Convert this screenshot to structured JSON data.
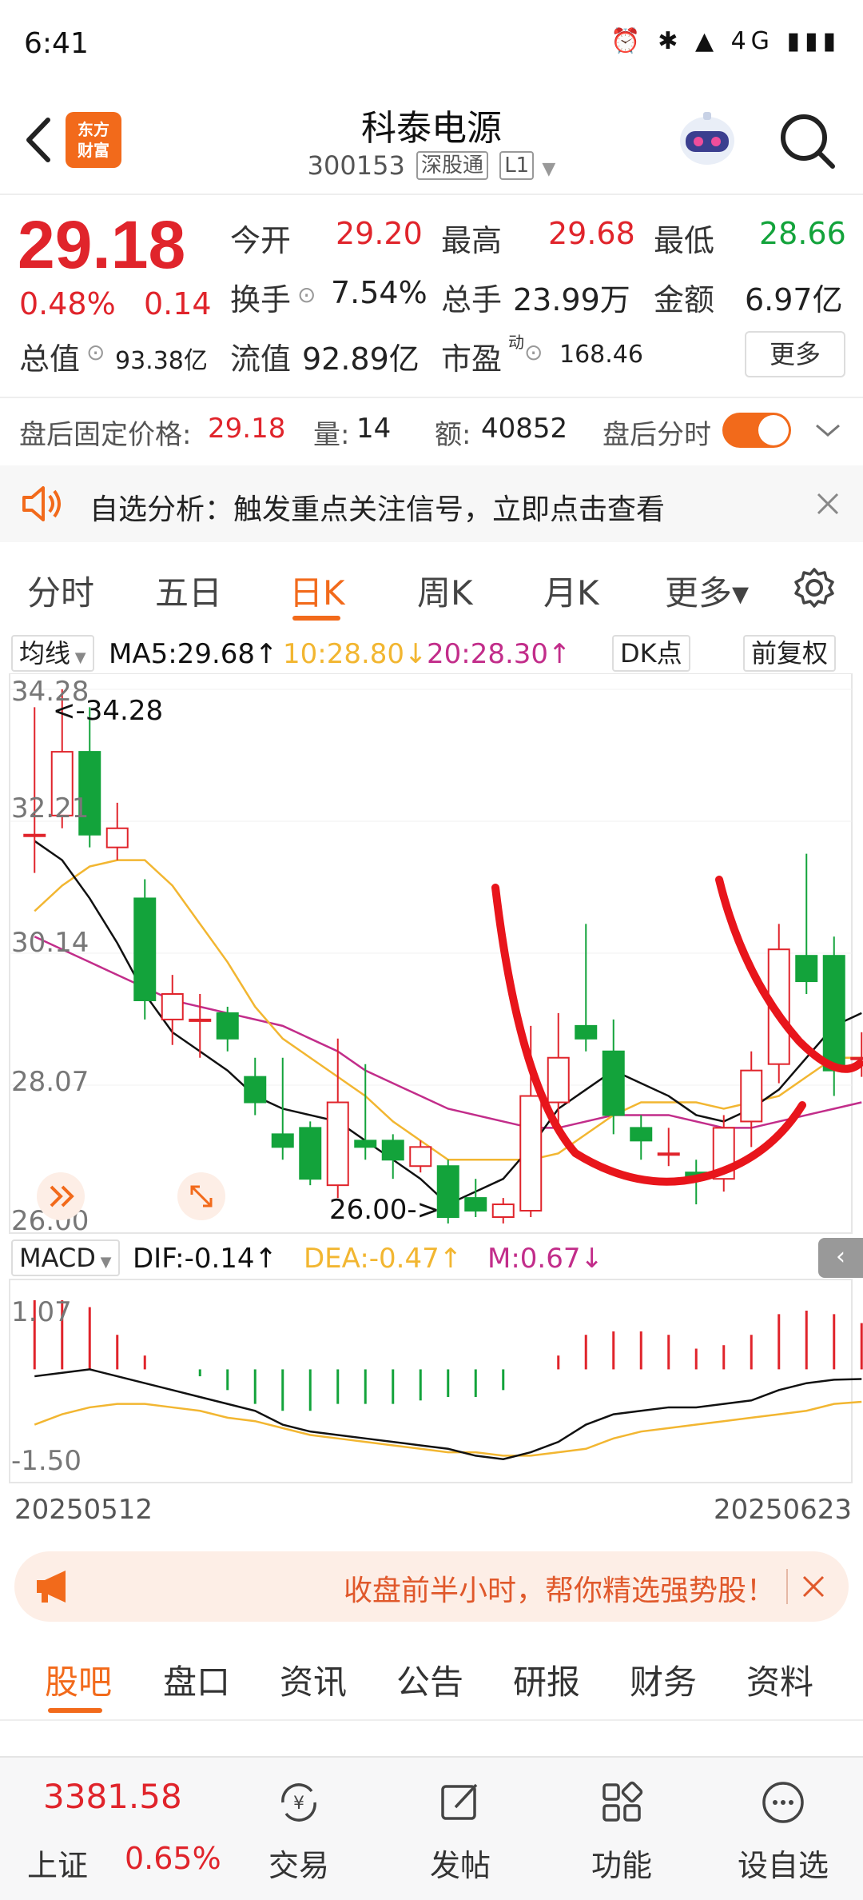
{
  "status_bar": {
    "time": "6:41",
    "icons": "⏰ ✱ ▲ 4G ▮▮▮"
  },
  "header": {
    "app_logo": "东方\n财富",
    "stock_name": "科泰电源",
    "stock_code": "300153",
    "tag_connect": "深股通",
    "tag_level": "L1"
  },
  "quote": {
    "price": "29.18",
    "pct_change": "0.48%",
    "abs_change": "0.14",
    "open_label": "今开",
    "open_value": "29.20",
    "high_label": "最高",
    "high_value": "29.68",
    "low_label": "最低",
    "low_value": "28.66",
    "turnover_label": "换手",
    "turnover_value": "7.54%",
    "volume_label": "总手",
    "volume_value": "23.99万",
    "amount_label": "金额",
    "amount_value": "6.97亿",
    "mktcap_label": "总值",
    "mktcap_value": "93.38亿",
    "float_label": "流值",
    "float_value": "92.89亿",
    "pe_label": "市盈",
    "pe_sup": "动",
    "pe_value": "168.46",
    "more_label": "更多"
  },
  "after_hours": {
    "price_label": "盘后固定价格:",
    "price_value": "29.18",
    "qty_label": "量:",
    "qty_value": "14",
    "amt_label": "额:",
    "amt_value": "40852",
    "toggle_label": "盘后分时"
  },
  "notice": {
    "text": "自选分析：触发重点关注信号，立即点击查看"
  },
  "chart_tabs": [
    "分时",
    "五日",
    "日K",
    "周K",
    "月K",
    "更多▾"
  ],
  "ma_row": {
    "selector": "均线",
    "ma5": "MA5:29.68↑",
    "ma10": "10:28.80↓",
    "ma20": "20:28.30↑",
    "dk_button": "DK点",
    "adjust_button": "前复权"
  },
  "colors": {
    "up": "#e0242b",
    "down": "#13a33b",
    "ma5": "#111111",
    "ma10": "#f2b631",
    "ma20": "#c22d8a",
    "accent": "#f26a1b"
  },
  "chart_data": {
    "type": "candlestick",
    "y_ticks": [
      "34.28",
      "32.21",
      "30.14",
      "28.07",
      "26.00"
    ],
    "ylim": [
      26.0,
      34.28
    ],
    "max_marker": "<-34.28",
    "min_marker": "26.00->",
    "candles": [
      {
        "o": 32.0,
        "c": 32.0,
        "h": 34.0,
        "l": 31.4
      },
      {
        "o": 32.3,
        "c": 33.3,
        "h": 34.28,
        "l": 32.1
      },
      {
        "o": 33.3,
        "c": 32.0,
        "h": 34.0,
        "l": 31.8
      },
      {
        "o": 31.8,
        "c": 32.1,
        "h": 32.5,
        "l": 31.6
      },
      {
        "o": 31.0,
        "c": 29.4,
        "h": 31.3,
        "l": 29.1
      },
      {
        "o": 29.1,
        "c": 29.5,
        "h": 29.8,
        "l": 28.7
      },
      {
        "o": 29.1,
        "c": 29.1,
        "h": 29.5,
        "l": 28.5
      },
      {
        "o": 29.2,
        "c": 28.8,
        "h": 29.3,
        "l": 28.6
      },
      {
        "o": 28.2,
        "c": 27.8,
        "h": 28.5,
        "l": 27.6
      },
      {
        "o": 27.3,
        "c": 27.1,
        "h": 28.5,
        "l": 26.9
      },
      {
        "o": 27.4,
        "c": 26.6,
        "h": 27.5,
        "l": 26.5
      },
      {
        "o": 26.5,
        "c": 27.8,
        "h": 28.8,
        "l": 26.3
      },
      {
        "o": 27.2,
        "c": 27.1,
        "h": 28.4,
        "l": 26.9
      },
      {
        "o": 27.2,
        "c": 26.9,
        "h": 27.3,
        "l": 26.6
      },
      {
        "o": 26.8,
        "c": 27.1,
        "h": 27.2,
        "l": 26.7
      },
      {
        "o": 26.8,
        "c": 26.0,
        "h": 26.9,
        "l": 25.9
      },
      {
        "o": 26.3,
        "c": 26.1,
        "h": 26.6,
        "l": 26.0
      },
      {
        "o": 26.0,
        "c": 26.2,
        "h": 26.3,
        "l": 25.9
      },
      {
        "o": 26.1,
        "c": 27.9,
        "h": 29.0,
        "l": 26.0
      },
      {
        "o": 27.8,
        "c": 28.5,
        "h": 29.2,
        "l": 27.4
      },
      {
        "o": 29.0,
        "c": 28.8,
        "h": 30.6,
        "l": 28.6
      },
      {
        "o": 28.6,
        "c": 27.6,
        "h": 29.1,
        "l": 27.3
      },
      {
        "o": 27.4,
        "c": 27.2,
        "h": 27.6,
        "l": 26.9
      },
      {
        "o": 27.0,
        "c": 27.0,
        "h": 27.4,
        "l": 26.8
      },
      {
        "o": 26.7,
        "c": 26.6,
        "h": 26.9,
        "l": 26.2
      },
      {
        "o": 26.6,
        "c": 27.4,
        "h": 27.6,
        "l": 26.4
      },
      {
        "o": 27.5,
        "c": 28.3,
        "h": 28.6,
        "l": 27.1
      },
      {
        "o": 28.4,
        "c": 30.2,
        "h": 30.6,
        "l": 28.1
      },
      {
        "o": 30.1,
        "c": 29.7,
        "h": 31.7,
        "l": 29.5
      },
      {
        "o": 30.1,
        "c": 28.3,
        "h": 30.4,
        "l": 27.9
      },
      {
        "o": 28.5,
        "c": 28.5,
        "h": 28.9,
        "l": 28.2
      }
    ],
    "ma5": [
      31.9,
      31.6,
      31.0,
      30.3,
      29.5,
      28.9,
      28.6,
      28.3,
      27.9,
      27.7,
      27.6,
      27.5,
      27.2,
      26.9,
      26.6,
      26.2,
      26.4,
      26.6,
      27.1,
      27.7,
      28.0,
      28.3,
      28.1,
      27.9,
      27.6,
      27.5,
      27.7,
      28.0,
      28.5,
      29.0,
      29.2
    ],
    "ma10": [
      30.8,
      31.2,
      31.5,
      31.6,
      31.6,
      31.2,
      30.6,
      30.0,
      29.3,
      28.8,
      28.5,
      28.2,
      27.9,
      27.5,
      27.2,
      26.9,
      26.9,
      26.9,
      26.9,
      27.0,
      27.3,
      27.6,
      27.8,
      27.8,
      27.8,
      27.7,
      27.8,
      27.9,
      28.2,
      28.5,
      28.5
    ],
    "ma20": [
      30.4,
      30.2,
      30.0,
      29.8,
      29.6,
      29.4,
      29.3,
      29.2,
      29.1,
      29.0,
      28.8,
      28.6,
      28.3,
      28.1,
      27.9,
      27.7,
      27.6,
      27.5,
      27.4,
      27.4,
      27.5,
      27.6,
      27.6,
      27.6,
      27.5,
      27.4,
      27.4,
      27.5,
      27.6,
      27.7,
      27.8
    ],
    "macd": {
      "label": "MACD",
      "dif": "DIF:-0.14↑",
      "dea": "DEA:-0.47↑",
      "m": "M:0.67↓",
      "y_ticks": [
        "1.07",
        "-1.50"
      ],
      "ylim": [
        -1.5,
        1.07
      ],
      "hist": [
        1.0,
        1.0,
        0.9,
        0.5,
        0.2,
        0.0,
        -0.1,
        -0.3,
        -0.5,
        -0.6,
        -0.6,
        -0.5,
        -0.5,
        -0.5,
        -0.45,
        -0.4,
        -0.4,
        -0.3,
        0.0,
        0.2,
        0.5,
        0.55,
        0.55,
        0.5,
        0.3,
        0.35,
        0.5,
        0.8,
        0.85,
        0.8,
        0.67
      ],
      "dif_line": [
        -0.1,
        -0.05,
        0.0,
        -0.1,
        -0.2,
        -0.3,
        -0.4,
        -0.5,
        -0.6,
        -0.8,
        -0.9,
        -0.95,
        -1.0,
        -1.05,
        -1.1,
        -1.15,
        -1.25,
        -1.3,
        -1.2,
        -1.05,
        -0.8,
        -0.65,
        -0.6,
        -0.55,
        -0.55,
        -0.5,
        -0.45,
        -0.3,
        -0.2,
        -0.15,
        -0.14
      ],
      "dea_line": [
        -0.8,
        -0.65,
        -0.55,
        -0.5,
        -0.5,
        -0.55,
        -0.6,
        -0.7,
        -0.75,
        -0.85,
        -0.95,
        -1.0,
        -1.05,
        -1.1,
        -1.15,
        -1.2,
        -1.2,
        -1.25,
        -1.25,
        -1.2,
        -1.15,
        -1.0,
        -0.9,
        -0.85,
        -0.8,
        -0.75,
        -0.7,
        -0.65,
        -0.6,
        -0.5,
        -0.47
      ]
    },
    "date_start": "20250512",
    "date_end": "20250623"
  },
  "promo": {
    "text": "收盘前半小时，帮你精选强势股！"
  },
  "bottom_tabs": [
    "股吧",
    "盘口",
    "资讯",
    "公告",
    "研报",
    "财务",
    "资料"
  ],
  "bottom_nav": {
    "index_value": "3381.58",
    "index_name": "上证",
    "index_change": "0.65%",
    "items": [
      "交易",
      "发帖",
      "功能",
      "设自选"
    ]
  }
}
